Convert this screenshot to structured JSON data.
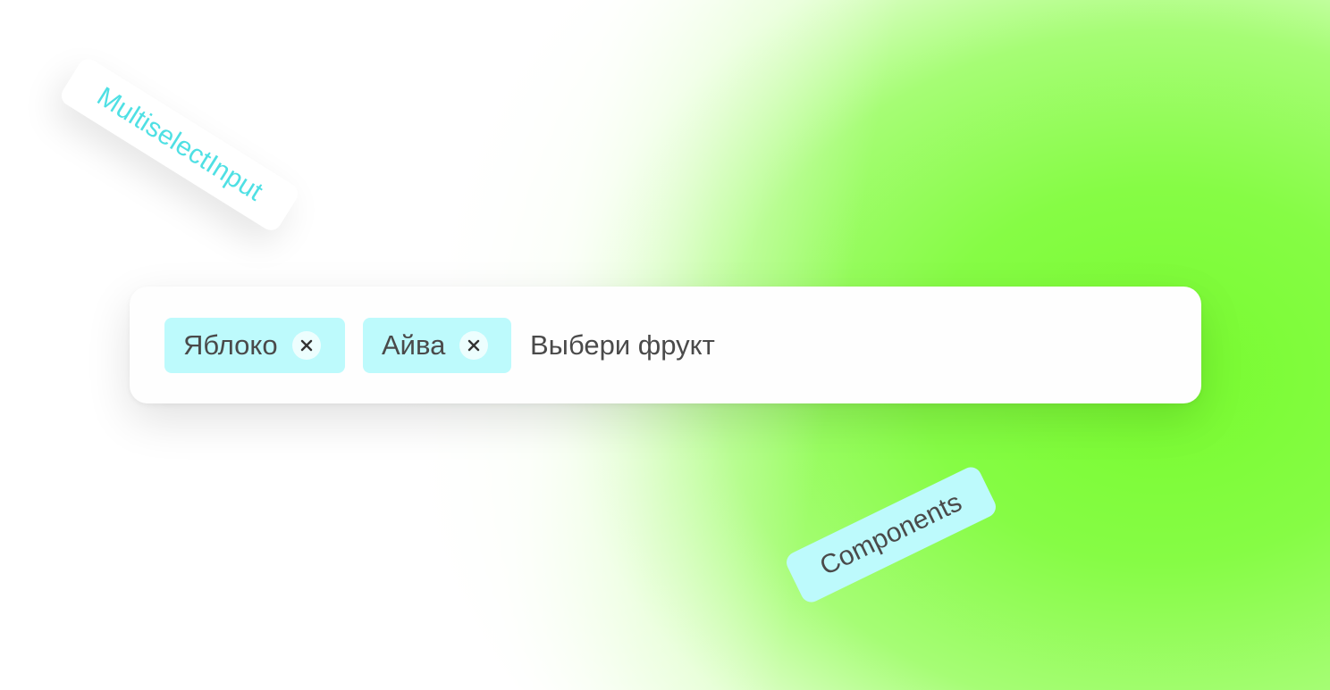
{
  "labels": {
    "multiselect_tag": "MultiselectInput",
    "components_tag": "Components"
  },
  "multiselect": {
    "chips": [
      {
        "label": "Яблоко",
        "remove_icon": "close-icon"
      },
      {
        "label": "Айва",
        "remove_icon": "close-icon"
      }
    ],
    "placeholder": "Выбери фрукт"
  },
  "colors": {
    "chip_background": "#bdfafc",
    "tag_text_accent": "#4fe0e4",
    "gradient_green": "#77fb2e",
    "text": "#4a4a4a"
  }
}
